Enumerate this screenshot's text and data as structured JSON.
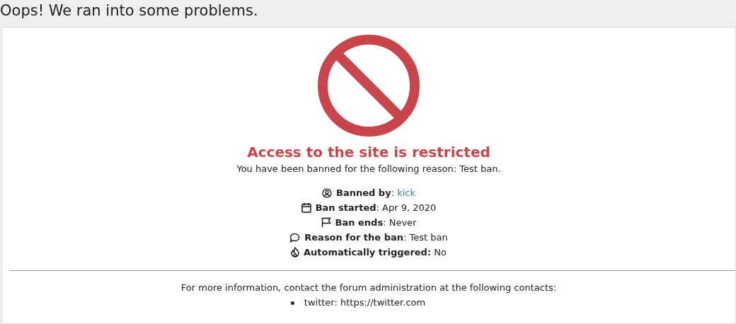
{
  "header": {
    "title": "Oops! We ran into some problems."
  },
  "ban": {
    "title": "Access to the site is restricted",
    "message": "You have been banned for the following reason: Test ban.",
    "details": [
      {
        "kind": "user",
        "label": "**Banned by**: ",
        "value": "kick",
        "link": true
      },
      {
        "kind": "calendar",
        "label": "**Ban started**: ",
        "value": "Apr 9, 2020",
        "link": false
      },
      {
        "kind": "flag",
        "label": "**Ban ends**: ",
        "value": "Never",
        "link": false
      },
      {
        "kind": "comment",
        "label": "**Reason for the ban**: ",
        "value": "Test ban",
        "link": false
      },
      {
        "kind": "fire",
        "label": "**Automatically triggered:** ",
        "value": "No",
        "link": false
      }
    ]
  },
  "contacts": {
    "intro": "For more information, contact the forum administration at the following contacts:",
    "items": [
      "twitter: https://twitter.com"
    ]
  }
}
